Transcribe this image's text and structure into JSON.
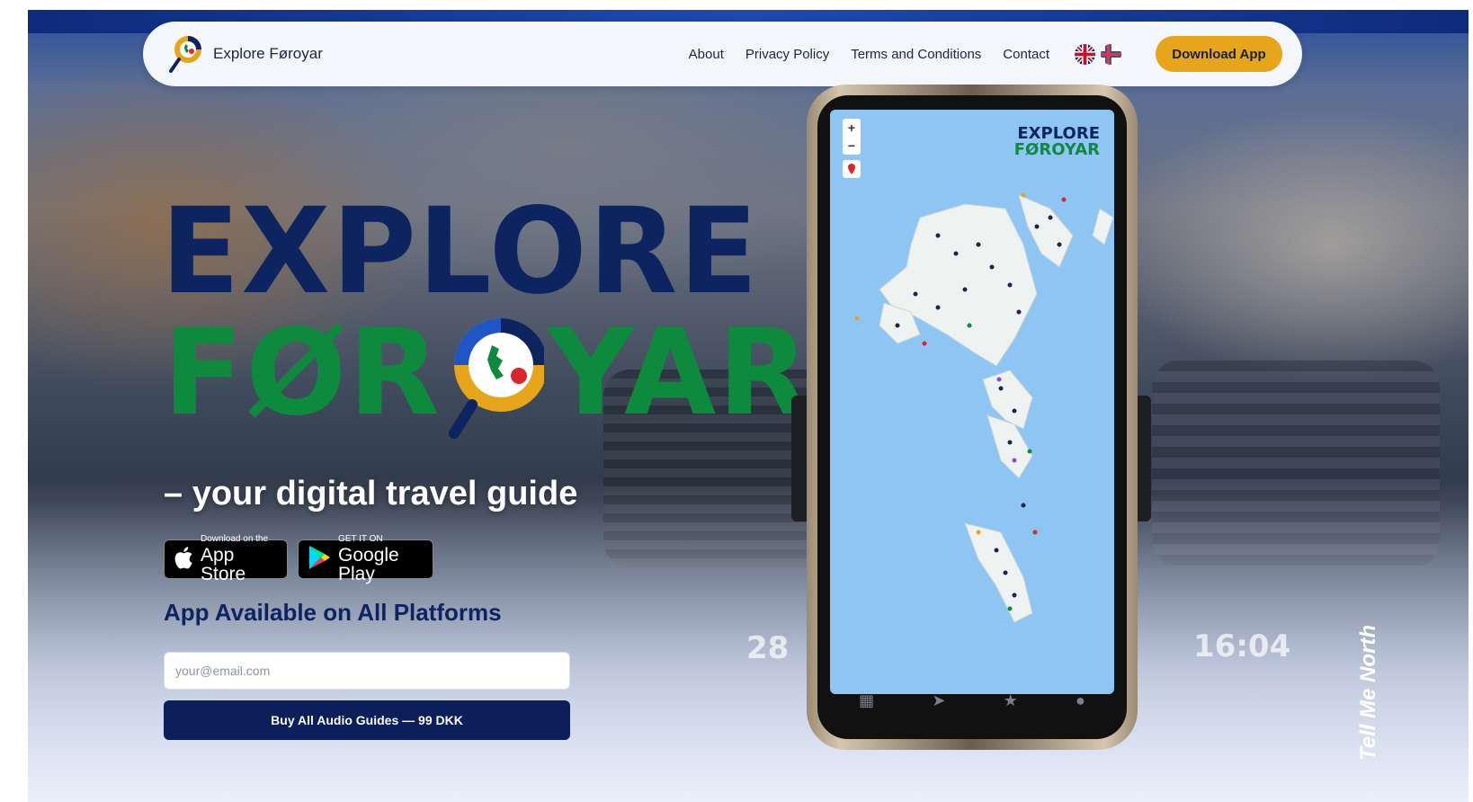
{
  "brand": {
    "name": "Explore Føroyar",
    "logo_icon": "magnifier-globe-icon"
  },
  "nav": {
    "links": [
      "About",
      "Privacy Policy",
      "Terms and Conditions",
      "Contact"
    ],
    "languages": [
      "en-flag-icon",
      "fo-flag-icon"
    ],
    "download_label": "Download App"
  },
  "hero": {
    "title_line1": "EXPLORE",
    "title_line2_a": "FØR",
    "title_line2_b": "YAR",
    "tagline": "– your digital travel guide",
    "platforms_heading": "App Available on All Platforms"
  },
  "stores": {
    "apple": {
      "small": "Download on the",
      "big": "App Store",
      "icon": "apple-icon"
    },
    "google": {
      "small": "GET IT ON",
      "big": "Google Play",
      "icon": "google-play-icon"
    }
  },
  "form": {
    "email_placeholder": "your@email.com",
    "buy_label": "Buy All Audio Guides — 99 DKK"
  },
  "phone": {
    "logo_line1": "EXPLORE",
    "logo_line2": "FØROYAR",
    "zoom_in": "+",
    "zoom_out": "−",
    "dash_left": "28",
    "dash_time": "16:04"
  },
  "watermark": "Tell Me North",
  "colors": {
    "navy": "#0d2460",
    "green": "#0e8a3e",
    "gold": "#e6a51a"
  }
}
